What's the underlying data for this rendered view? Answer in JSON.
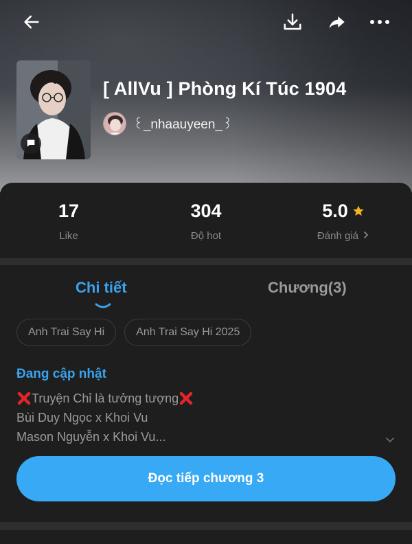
{
  "header": {
    "back_icon": "arrow-left-icon",
    "download_icon": "download-icon",
    "share_icon": "share-icon",
    "more_icon": "more-horizontal-icon"
  },
  "story": {
    "title": "[ AllVu ] Phòng Kí Túc 1904",
    "author": "꒰_nhaauyeen_꒱",
    "cover_badge_icon": "chat-bubble-icon"
  },
  "stats": {
    "likes": {
      "value": "17",
      "label": "Like"
    },
    "hot": {
      "value": "304",
      "label": "Độ hot"
    },
    "rating": {
      "value": "5.0",
      "label": "Đánh giá",
      "star_icon": "star-icon",
      "chevron_icon": "chevron-right-icon"
    }
  },
  "tabs": {
    "detail": "Chi tiết",
    "chapters": "Chương(3)"
  },
  "tags": [
    "Anh Trai Say Hi",
    "Anh Trai Say Hi 2025"
  ],
  "status": "Đang cập nhật",
  "description": {
    "line1": "Truyện Chỉ là tưởng tượng",
    "line2": "Bùi Duy Ngọc x Khoi Vu",
    "line3": "Mason Nguyễn x Khoi Vu..."
  },
  "cta": "Đọc tiếp chương 3",
  "colors": {
    "accent": "#38a9f5",
    "star": "#f5b324",
    "cross": "#e0262a"
  }
}
